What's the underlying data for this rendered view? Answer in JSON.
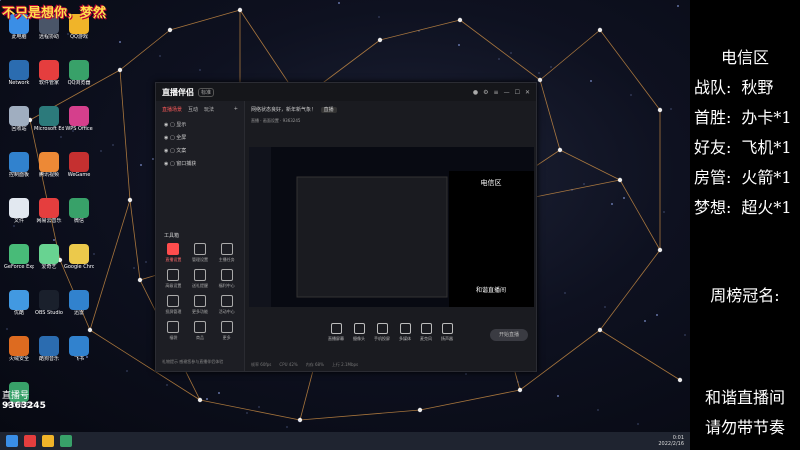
{
  "overlay": {
    "title": "不只是想你，梦然"
  },
  "desktop_icons": [
    {
      "label": "此电脑",
      "color": "#3a8ee6"
    },
    {
      "label": "远程协助",
      "color": "#4a5568"
    },
    {
      "label": "QQ游戏",
      "color": "#f0b429"
    },
    {
      "label": "Network",
      "color": "#2b6cb0"
    },
    {
      "label": "软件管家",
      "color": "#e53e3e"
    },
    {
      "label": "QQ浏览器",
      "color": "#38a169"
    },
    {
      "label": "回收站",
      "color": "#a0aec0"
    },
    {
      "label": "Microsoft Edge",
      "color": "#2c7a7b"
    },
    {
      "label": "WPS Office",
      "color": "#d53f8c"
    },
    {
      "label": "控制面板",
      "color": "#3182ce"
    },
    {
      "label": "腾讯视频",
      "color": "#ed8936"
    },
    {
      "label": "WeGame",
      "color": "#c53030"
    },
    {
      "label": "文件",
      "color": "#e2e8f0"
    },
    {
      "label": "网易云音乐",
      "color": "#e53e3e"
    },
    {
      "label": "微信",
      "color": "#38a169"
    },
    {
      "label": "GeForce Experience",
      "color": "#48bb78"
    },
    {
      "label": "爱奇艺",
      "color": "#68d391"
    },
    {
      "label": "Google Chrome",
      "color": "#ecc94b"
    },
    {
      "label": "优酷",
      "color": "#4299e1"
    },
    {
      "label": "OBS Studio",
      "color": "#1a202c"
    },
    {
      "label": "迅雷",
      "color": "#3182ce"
    },
    {
      "label": "火绒安全",
      "color": "#dd6b20"
    },
    {
      "label": "酷狗音乐",
      "color": "#2b6cb0"
    },
    {
      "label": "飞书",
      "color": "#3182ce"
    },
    {
      "label": "360安全卫士",
      "color": "#38a169"
    }
  ],
  "qq_badge": {
    "label": "直播号",
    "number": "9363245"
  },
  "app": {
    "logo": "直播伴侣",
    "version": "标准",
    "tabs": [
      "直播场景",
      "互动",
      "玩法"
    ],
    "scenes": [
      "显示",
      "全屏",
      "文案",
      "窗口捕获"
    ],
    "tools_title": "工具箱",
    "tools": [
      "直播设置",
      "管理设置",
      "主播任务",
      "高级设置",
      "送礼提醒",
      "福利中心",
      "投屏管理",
      "更多功能",
      "活动中心",
      "福袋",
      "商品",
      "更多"
    ],
    "footer_note": "礼物提示  感谢您参与直播伴侣体验",
    "main_title": "网络状态良好，新年新气象！",
    "main_tag": "直播",
    "main_sub": "直播 · 画面设置 · 9363245",
    "bottom_buttons": [
      "直播屏幕",
      "摄像头",
      "手机投屏",
      "多媒体",
      "麦克风",
      "扬声器"
    ],
    "start_button": "开始直播",
    "status": [
      "帧率 60fps",
      "CPU 42%",
      "内存 68%",
      "上行 2.1Mbps"
    ]
  },
  "taskbar": {
    "time": "0:01",
    "date": "2022/2/16"
  },
  "panel": {
    "title": "电信区",
    "rows": [
      {
        "key": "战队:",
        "value": "秋野"
      },
      {
        "key": "首胜:",
        "value": "办卡*1"
      },
      {
        "key": "好友:",
        "value": "飞机*1"
      },
      {
        "key": "房管:",
        "value": "火箭*1"
      },
      {
        "key": "梦想:",
        "value": "超火*1"
      }
    ],
    "weekly": "周榜冠名:",
    "footer1": "和谐直播间",
    "footer2": "请勿带节奏"
  }
}
